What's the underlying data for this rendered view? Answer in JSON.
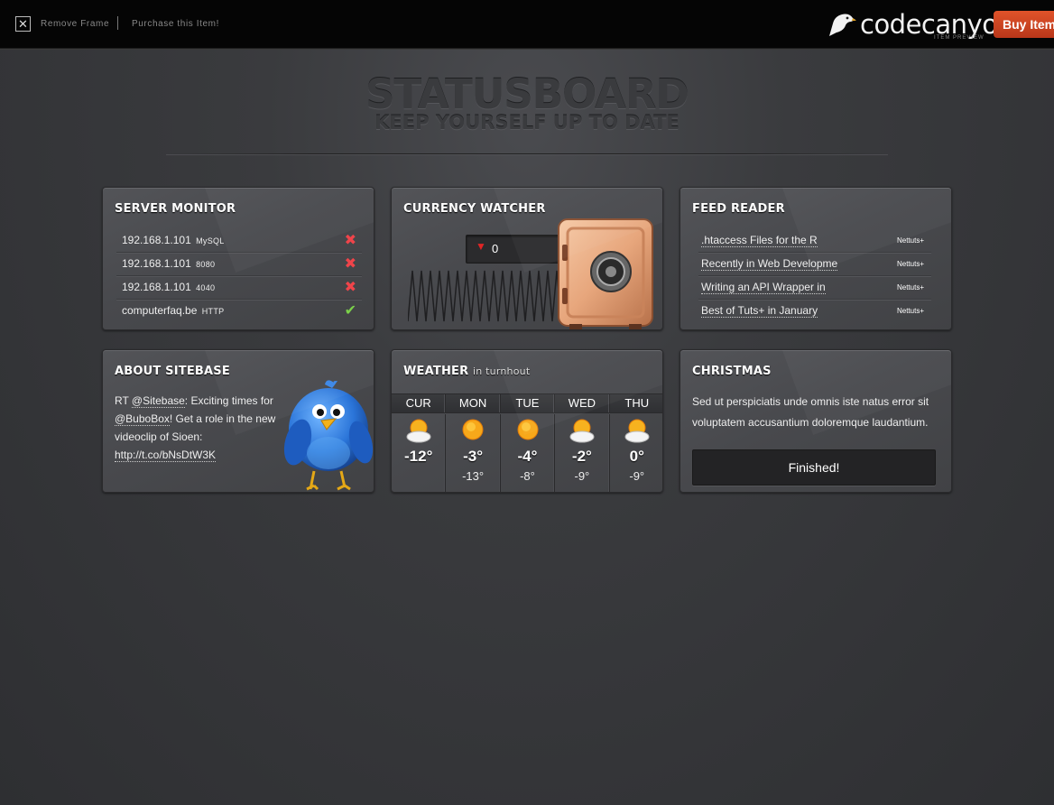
{
  "topbar": {
    "close_glyph": "✕",
    "remove_frame": "Remove Frame",
    "purchase": "Purchase this Item!",
    "brand": "codecanyon",
    "brand_sub": "ITEM PREVIEW",
    "buy": "Buy Item"
  },
  "header": {
    "title": "STATUSBOARD",
    "subtitle": "KEEP YOURSELF UP TO DATE"
  },
  "server_monitor": {
    "title": "SERVER MONITOR",
    "rows": [
      {
        "host": "192.168.1.101",
        "service": "MySQL",
        "status": "down"
      },
      {
        "host": "192.168.1.101",
        "service": "8080",
        "status": "down"
      },
      {
        "host": "192.168.1.101",
        "service": "4040",
        "status": "down"
      },
      {
        "host": "computerfaq.be",
        "service": "HTTP",
        "status": "up"
      }
    ],
    "down_glyph": "✖",
    "up_glyph": "✔"
  },
  "currency": {
    "title": "CURRENCY WATCHER",
    "trend_glyph": "▼",
    "value": "0"
  },
  "feed": {
    "title": "FEED READER",
    "items": [
      {
        "title": ".htaccess Files for the R",
        "source": "Nettuts+"
      },
      {
        "title": "Recently in Web Developme",
        "source": "Nettuts+"
      },
      {
        "title": "Writing an API Wrapper in",
        "source": "Nettuts+"
      },
      {
        "title": "Best of Tuts+ in January",
        "source": "Nettuts+"
      }
    ]
  },
  "about": {
    "title": "ABOUT SITEBASE",
    "rt": "RT ",
    "mention1": "@Sitebase",
    "text1": ": Exciting times for ",
    "mention2": "@BuboBox",
    "text2": "! Get a role in the new videoclip of Sioen: ",
    "link": "http://t.co/bNsDtW3K"
  },
  "weather": {
    "title": "WEATHER",
    "location": "in turnhout",
    "days": [
      {
        "label": "CUR",
        "icon": "partly-cloudy-icon",
        "hi": "-12°",
        "lo": ""
      },
      {
        "label": "MON",
        "icon": "sun-icon",
        "hi": "-3°",
        "lo": "-13°"
      },
      {
        "label": "TUE",
        "icon": "sun-icon",
        "hi": "-4°",
        "lo": "-8°"
      },
      {
        "label": "WED",
        "icon": "partly-cloudy-icon",
        "hi": "-2°",
        "lo": "-9°"
      },
      {
        "label": "THU",
        "icon": "partly-cloudy-icon",
        "hi": "0°",
        "lo": "-9°"
      }
    ]
  },
  "christmas": {
    "title": "CHRISTMAS",
    "text": "Sed ut perspiciatis unde omnis iste natus error sit voluptatem accusantium doloremque laudantium.",
    "button": "Finished!"
  },
  "colors": {
    "accent_buy": "#d4461f",
    "status_down": "#f0444a",
    "status_up": "#7bd14a"
  }
}
